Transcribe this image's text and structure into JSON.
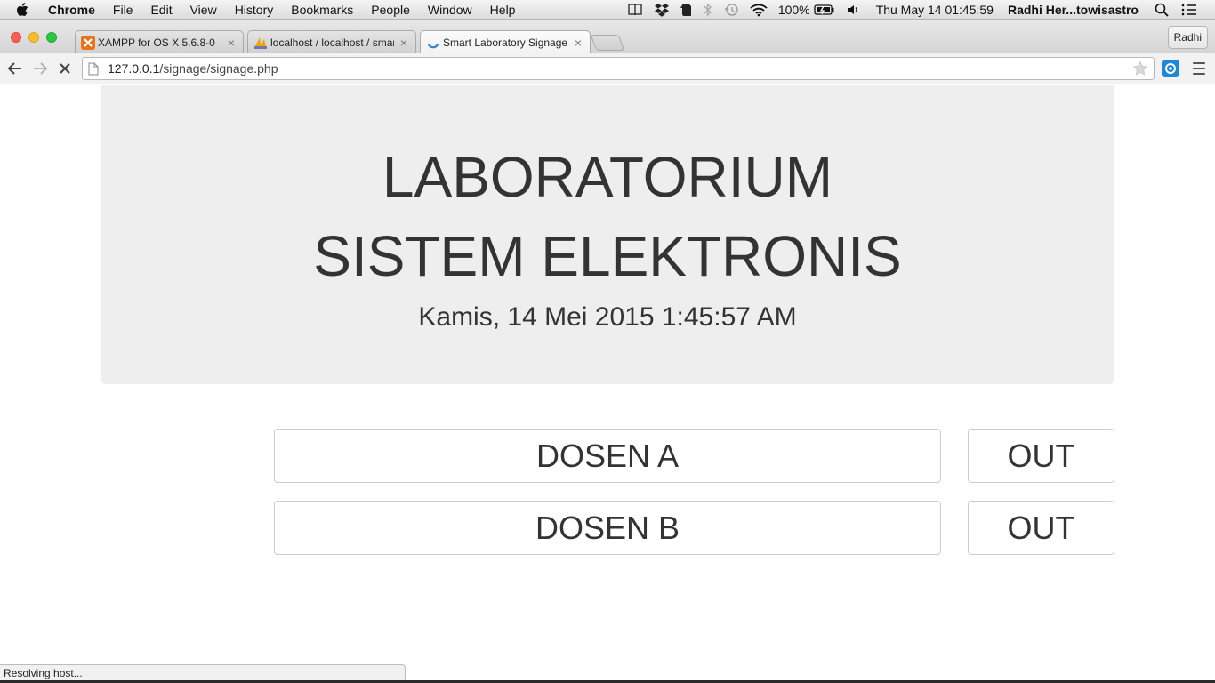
{
  "menubar": {
    "app_name": "Chrome",
    "items": [
      "File",
      "Edit",
      "View",
      "History",
      "Bookmarks",
      "People",
      "Window",
      "Help"
    ],
    "battery": "100%",
    "clock": "Thu May 14  01:45:59",
    "user": "Radhi Her...towisastro",
    "status_icons": [
      "book-icon",
      "dropbox-icon",
      "evernote-icon",
      "bluetooth-icon",
      "time-machine-icon",
      "wifi-icon",
      "battery-icon",
      "volume-icon",
      "spotlight-icon",
      "notification-center-icon"
    ]
  },
  "tabs": [
    {
      "title": "XAMPP for OS X 5.6.8-0",
      "icon": "xampp-icon",
      "close": "×"
    },
    {
      "title": "localhost / localhost / smar",
      "icon": "phpmyadmin-icon",
      "close": "×"
    },
    {
      "title": "Smart Laboratory Signage",
      "icon": "loading-spinner-icon",
      "close": "×",
      "active": true
    }
  ],
  "profile_button": "Radhi",
  "toolbar": {
    "url_host": "127.0.0.1",
    "url_path": "/signage/signage.php"
  },
  "page": {
    "title_line1": "LABORATORIUM",
    "title_line2": "SISTEM ELEKTRONIS",
    "datetime": "Kamis, 14 Mei 2015 1:45:57 AM",
    "rows": [
      {
        "name": "DOSEN A",
        "status": "OUT"
      },
      {
        "name": "DOSEN B",
        "status": "OUT"
      }
    ]
  },
  "statusbar": "Resolving host...",
  "colors": {
    "jumbotron_bg": "#eeeeee",
    "text": "#333333",
    "button_border": "#cccccc"
  }
}
